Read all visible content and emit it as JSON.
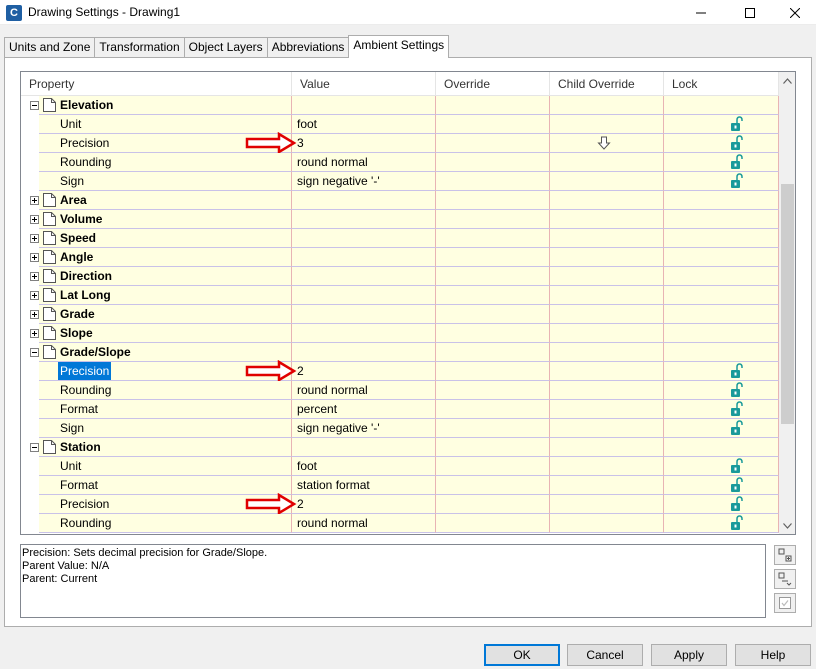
{
  "window": {
    "title": "Drawing Settings - Drawing1",
    "app_icon_letter": "C"
  },
  "tabs": [
    {
      "label": "Units and Zone",
      "active": false
    },
    {
      "label": "Transformation",
      "active": false
    },
    {
      "label": "Object Layers",
      "active": false
    },
    {
      "label": "Abbreviations",
      "active": false
    },
    {
      "label": "Ambient Settings",
      "active": true
    }
  ],
  "grid": {
    "columns": [
      "Property",
      "Value",
      "Override",
      "Child Override",
      "Lock"
    ],
    "rows": [
      {
        "type": "group",
        "expanded": true,
        "label": "Elevation"
      },
      {
        "type": "prop",
        "label": "Unit",
        "value": "foot",
        "lock": true
      },
      {
        "type": "prop",
        "label": "Precision",
        "value": "3",
        "lock": true,
        "child_override": true,
        "arrow": true
      },
      {
        "type": "prop",
        "label": "Rounding",
        "value": "round normal",
        "lock": true
      },
      {
        "type": "prop",
        "label": "Sign",
        "value": "sign negative '-'",
        "lock": true
      },
      {
        "type": "group",
        "expanded": false,
        "label": "Area"
      },
      {
        "type": "group",
        "expanded": false,
        "label": "Volume"
      },
      {
        "type": "group",
        "expanded": false,
        "label": "Speed"
      },
      {
        "type": "group",
        "expanded": false,
        "label": "Angle"
      },
      {
        "type": "group",
        "expanded": false,
        "label": "Direction"
      },
      {
        "type": "group",
        "expanded": false,
        "label": "Lat Long"
      },
      {
        "type": "group",
        "expanded": false,
        "label": "Grade"
      },
      {
        "type": "group",
        "expanded": false,
        "label": "Slope"
      },
      {
        "type": "group",
        "expanded": true,
        "label": "Grade/Slope"
      },
      {
        "type": "prop",
        "label": "Precision",
        "value": "2",
        "lock": true,
        "selected": true,
        "arrow": true
      },
      {
        "type": "prop",
        "label": "Rounding",
        "value": "round normal",
        "lock": true
      },
      {
        "type": "prop",
        "label": "Format",
        "value": "percent",
        "lock": true
      },
      {
        "type": "prop",
        "label": "Sign",
        "value": "sign negative '-'",
        "lock": true
      },
      {
        "type": "group",
        "expanded": true,
        "label": "Station"
      },
      {
        "type": "prop",
        "label": "Unit",
        "value": "foot",
        "lock": true
      },
      {
        "type": "prop",
        "label": "Format",
        "value": "station format",
        "lock": true
      },
      {
        "type": "prop",
        "label": "Precision",
        "value": "2",
        "lock": true,
        "arrow": true
      },
      {
        "type": "prop",
        "label": "Rounding",
        "value": "round normal",
        "lock": true
      }
    ]
  },
  "description": {
    "line1": "Precision: Sets decimal precision for Grade/Slope.",
    "line2": "Parent Value: N/A",
    "line3": "Parent: Current"
  },
  "buttons": {
    "ok": "OK",
    "cancel": "Cancel",
    "apply": "Apply",
    "help": "Help"
  },
  "colors": {
    "cell_bg": "#ffffe1",
    "selection": "#0078d7",
    "arrow": "#e00000",
    "lock": "#1a9a9a"
  }
}
